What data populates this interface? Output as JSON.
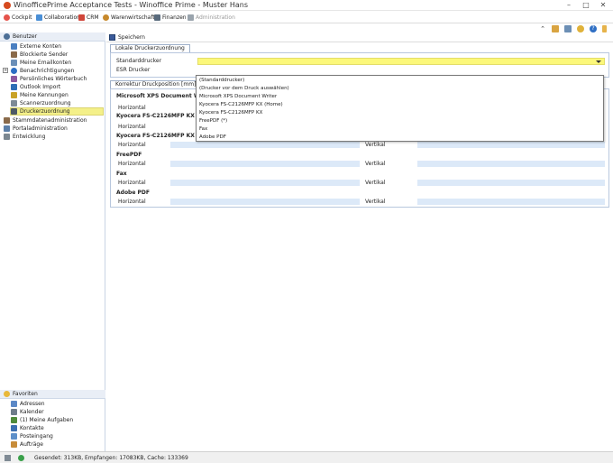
{
  "window": {
    "title": "WinofficePrime Acceptance Tests - Winoffice Prime - Muster Hans"
  },
  "menu": [
    {
      "label": "Cockpit",
      "icon": "cockpit-icon",
      "color": "#e5534b"
    },
    {
      "label": "Collaboration",
      "icon": "collaboration-icon",
      "color": "#4a8fd6"
    },
    {
      "label": "CRM",
      "icon": "crm-icon",
      "color": "#d0463a"
    },
    {
      "label": "Warenwirtschaft",
      "icon": "warehouse-icon",
      "color": "#c7892b"
    },
    {
      "label": "Finanzen",
      "icon": "finance-icon",
      "color": "#5a6b7d"
    },
    {
      "label": "Administration",
      "icon": "administration-icon",
      "color": "#9aa4ad"
    }
  ],
  "sidebar": {
    "header": "Benutzer",
    "items": [
      {
        "label": "Externe Konten",
        "icon": "external-accounts-icon",
        "color": "#4a7fc1",
        "level": 1
      },
      {
        "label": "Blockierte Sender",
        "icon": "blocked-sender-icon",
        "color": "#8a6a4a",
        "level": 1
      },
      {
        "label": "Meine Emailkonten",
        "icon": "email-accounts-icon",
        "color": "#6b8fb8",
        "level": 1
      },
      {
        "label": "Benachrichtigungen",
        "icon": "notifications-icon",
        "color": "#2d6fc4",
        "level": 1
      },
      {
        "label": "Persönliches Wörterbuch",
        "icon": "dictionary-icon",
        "color": "#8e5aa0",
        "level": 1
      },
      {
        "label": "Outlook Import",
        "icon": "outlook-icon",
        "color": "#2f6fb6",
        "level": 1
      },
      {
        "label": "Meine Kennungen",
        "icon": "identifiers-icon",
        "color": "#c9a227",
        "level": 1
      },
      {
        "label": "Scannerzuordnung",
        "icon": "scanner-icon",
        "color": "#7d8a96",
        "level": 1
      },
      {
        "label": "Druckerzuordnung",
        "icon": "printer-icon",
        "color": "#4d5964",
        "level": 1
      },
      {
        "label": "Stammdatenadministration",
        "icon": "master-data-icon",
        "color": "#8a6a4a",
        "level": 0
      },
      {
        "label": "Portaladministration",
        "icon": "portal-icon",
        "color": "#5c7fa8",
        "level": 0
      },
      {
        "label": "Entwicklung",
        "icon": "development-icon",
        "color": "#7b8791",
        "level": 0
      }
    ],
    "favorites_header": "Favoriten",
    "favorites": [
      {
        "label": "Adressen",
        "icon": "addresses-icon",
        "color": "#5b88c6"
      },
      {
        "label": "Kalender",
        "icon": "calendar-icon",
        "color": "#6f7c8a"
      },
      {
        "label": "(1) Meine Aufgaben",
        "icon": "tasks-icon",
        "color": "#4f8b3a"
      },
      {
        "label": "Kontakte",
        "icon": "contacts-icon",
        "color": "#3b6fb0"
      },
      {
        "label": "Posteingang",
        "icon": "inbox-icon",
        "color": "#5d8fc9"
      },
      {
        "label": "Aufträge",
        "icon": "orders-icon",
        "color": "#c78c3a"
      }
    ]
  },
  "toolbar": {
    "save_label": "Speichern"
  },
  "local_printers": {
    "tab_label": "Lokale Druckerzuordnung",
    "standard_label": "Standarddrucker",
    "esr_label": "ESR Drucker"
  },
  "position_correction": {
    "tab_label": "Korrektur Druckposition [mm]",
    "horizontal_label": "Horizontal",
    "vertical_label": "Vertikal",
    "printers": [
      "Microsoft XPS Document Writer",
      "Kyocera FS-C2126MFP KX (Home)",
      "Kyocera FS-C2126MFP KX",
      "FreePDF",
      "Fax",
      "Adobe PDF"
    ]
  },
  "dropdown_options": [
    "(Standarddrucker)",
    "(Drucker vor dem Druck auswählen)",
    "Microsoft XPS Document Writer",
    "Kyocera FS-C2126MFP KX (Home)",
    "Kyocera FS-C2126MFP KX",
    "FreePDF (*)",
    "Fax",
    "Adobe PDF"
  ],
  "status": {
    "text": "Gesendet: 313KB, Empfangen: 17083KB, Cache: 133369"
  },
  "colors": {
    "accent_yellow": "#fcf87a",
    "field_blue": "#dce9f8",
    "selection": "#f4f089"
  }
}
